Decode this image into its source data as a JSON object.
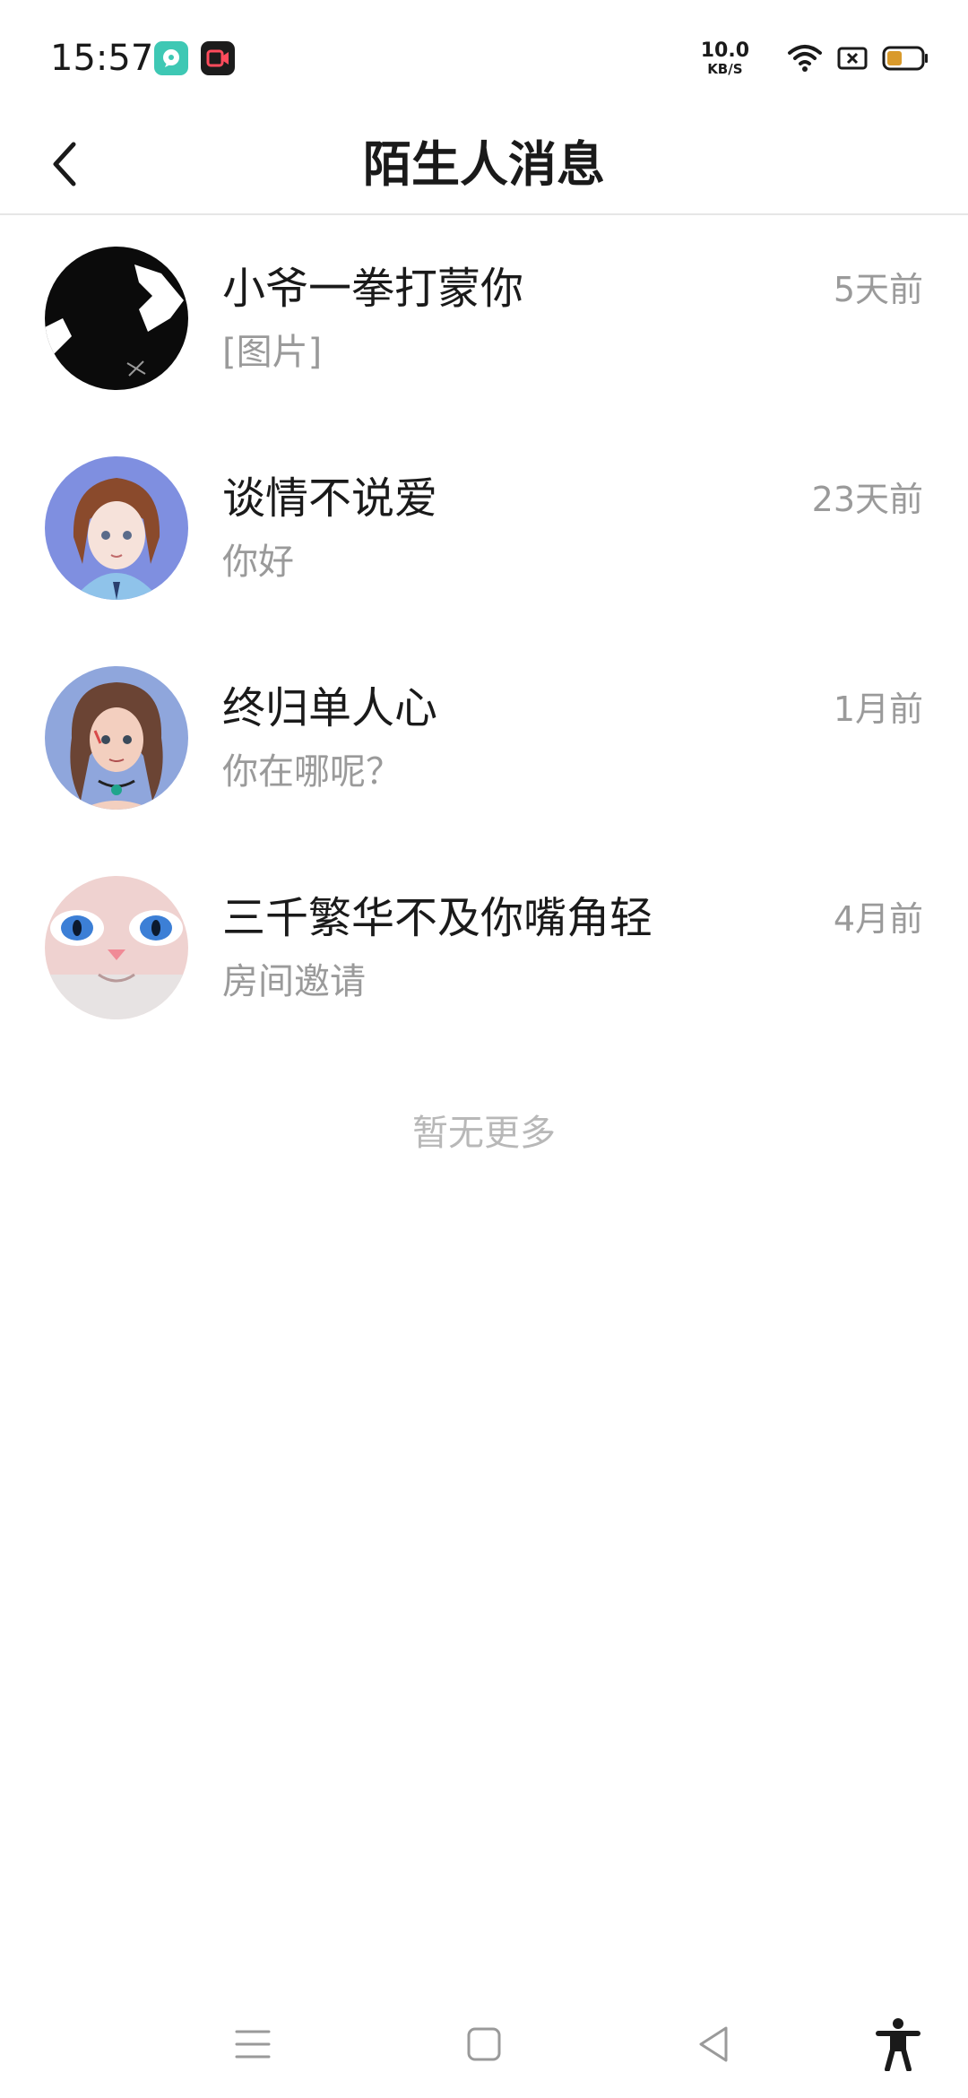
{
  "status_bar": {
    "time": "15:57",
    "net_speed_value": "10.0",
    "net_speed_unit": "KB/S",
    "battery_color": "#d99a2b",
    "icons": [
      "chat-app-icon",
      "screen-recorder-icon",
      "wifi-icon",
      "no-sim-icon",
      "battery-icon"
    ]
  },
  "header": {
    "title": "陌生人消息",
    "back_icon": "chevron-left-icon"
  },
  "messages": [
    {
      "name": "小爷一拳打蒙你",
      "preview": "[图片]",
      "time": "5天前"
    },
    {
      "name": "谈情不说爱",
      "preview": "你好",
      "time": "23天前"
    },
    {
      "name": "终归单人心",
      "preview": "你在哪呢？",
      "time": "1月前"
    },
    {
      "name": "三千繁华不及你嘴角轻",
      "preview": "房间邀请",
      "time": "4月前"
    }
  ],
  "footer": {
    "no_more": "暂无更多"
  },
  "nav_bar": {
    "icons": [
      "menu-icon",
      "home-icon",
      "back-triangle-icon",
      "accessibility-icon"
    ]
  }
}
